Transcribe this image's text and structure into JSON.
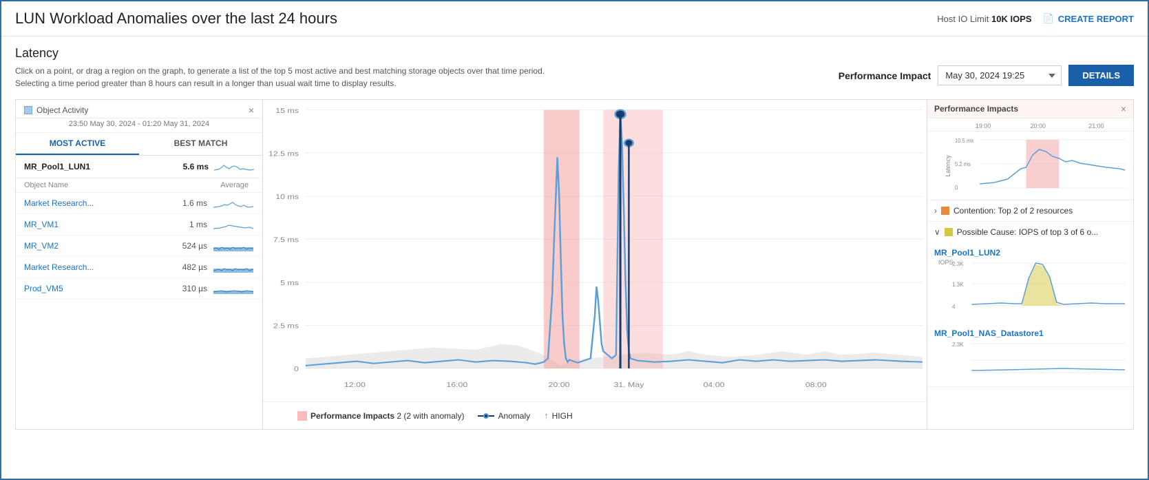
{
  "header": {
    "title": "LUN Workload Anomalies over the last 24 hours",
    "host_io_label": "Host IO Limit",
    "host_io_value": "10K IOPS",
    "create_report": "CREATE REPORT"
  },
  "latency_section": {
    "title": "Latency",
    "description_line1": "Click on a point, or drag a region on the graph, to generate a list of the top 5 most active and best matching storage objects over that time period.",
    "description_line2": "Selecting a time period greater than 8 hours can result in a longer than usual wait time to display results.",
    "perf_impact_label": "Performance Impact",
    "perf_date_value": "May 30, 2024 19:25",
    "details_button": "DETAILS"
  },
  "object_activity": {
    "icon_label": "Object Activity",
    "date_range": "23:50 May 30, 2024 - 01:20 May 31, 2024",
    "tab_most_active": "MOST ACTIVE",
    "tab_best_match": "BEST MATCH",
    "top_item": {
      "name": "MR_Pool1_LUN1",
      "value": "5.6 ms"
    },
    "col_headers": {
      "name": "Object Name",
      "value": "Average"
    },
    "rows": [
      {
        "name": "Market Research...",
        "value": "1.6 ms",
        "link": true
      },
      {
        "name": "MR_VM1",
        "value": "1 ms",
        "link": true
      },
      {
        "name": "MR_VM2",
        "value": "524 µs",
        "link": true
      },
      {
        "name": "Market Research...",
        "value": "482 µs",
        "link": true
      },
      {
        "name": "Prod_VM5",
        "value": "310 µs",
        "link": true
      }
    ]
  },
  "chart": {
    "y_axis_labels": [
      "15 ms",
      "12.5 ms",
      "10 ms",
      "7.5 ms",
      "5 ms",
      "2.5 ms",
      "0"
    ],
    "x_axis_labels": [
      "12:00",
      "16:00",
      "20:00",
      "31. May",
      "04:00",
      "08:00"
    ],
    "legend": {
      "perf_impacts_label": "Performance Impacts",
      "perf_impacts_count": "2 (2 with anomaly)",
      "anomaly_label": "Anomaly",
      "severity_label": "HIGH"
    }
  },
  "right_panel": {
    "header": "Performance Impacts",
    "time_labels": [
      "19:00",
      "20:00",
      "21:00"
    ],
    "latency_y": [
      "10.5 ms",
      "5.2 ms",
      "0"
    ],
    "contention": {
      "label": "Contention: Top 2 of 2 resources",
      "expanded": false
    },
    "possible_cause": {
      "label": "Possible Cause: IOPS of top 3 of 6 o...",
      "expanded": true,
      "items": [
        {
          "name": "MR_Pool1_LUN2",
          "iops_y": [
            "2.3K",
            "1.3K",
            "4"
          ]
        },
        {
          "name": "MR_Pool1_NAS_Datastore1",
          "iops_y": [
            "2.3K"
          ]
        }
      ]
    }
  },
  "icons": {
    "create_report": "📄",
    "close": "×",
    "chevron_right": "›",
    "chevron_down": "∨",
    "arrow_up": "↑"
  }
}
